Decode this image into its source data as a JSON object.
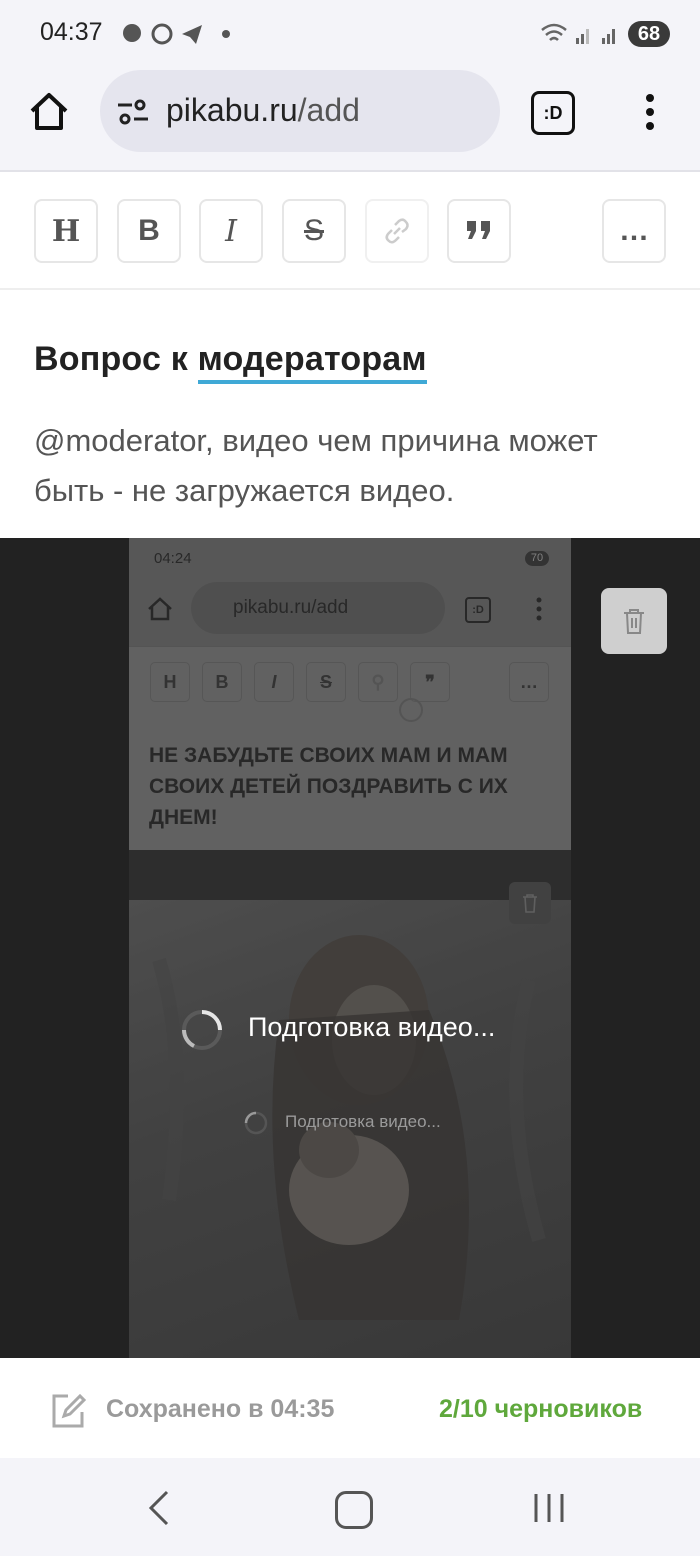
{
  "status": {
    "time": "04:37",
    "battery": "68"
  },
  "browser": {
    "url_host": "pikabu.ru",
    "url_path": "/add",
    "tab_badge": ":D"
  },
  "toolbar": {
    "heading": "H",
    "bold": "B",
    "italic": "I",
    "strike": "S",
    "more": "…"
  },
  "post": {
    "title_prefix": "Вопрос к ",
    "title_highlight": "модераторам",
    "body": "@moderator, видео чем причина может быть - не загружается видео."
  },
  "video": {
    "preparing": "Подготовка видео...",
    "inner": {
      "time": "04:24",
      "battery": "70",
      "url": "pikabu.ru/add",
      "tab_badge": ":D",
      "text": "НЕ ЗАБУДЬТЕ СВОИХ МАМ И МАМ СВОИХ ДЕТЕЙ ПОЗДРАВИТЬ С ИХ ДНЕМ!",
      "preparing": "Подготовка видео..."
    }
  },
  "footer": {
    "saved": "Сохранено в 04:35",
    "drafts": "2/10 черновиков"
  }
}
